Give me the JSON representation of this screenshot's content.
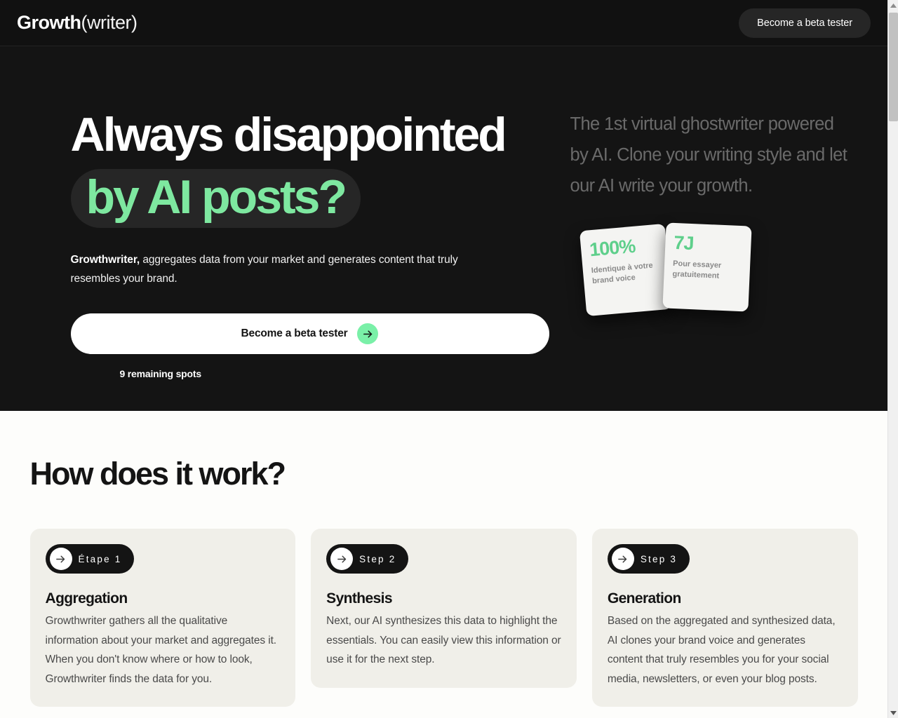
{
  "colors": {
    "hero_bg": "#141414",
    "header_bg": "#111111",
    "page_bg": "#fdfdfb",
    "accent_green": "#7ee8a0",
    "arrow_green": "#7af0a8",
    "stat_green": "#5ecf8b",
    "card_bg": "#f0efe9",
    "pill_bg": "#262626",
    "muted_text": "#6a6a6a"
  },
  "header": {
    "logo": {
      "strong": "Growth",
      "light": "(writer)"
    },
    "cta_label": "Become a beta tester"
  },
  "hero": {
    "headline_line1": "Always disappointed",
    "headline_line2": "by AI posts?",
    "sub_bold": "Growthwriter,",
    "sub_rest": " aggregates data from your market and generates content that truly resembles your brand.",
    "cta_label": "Become a beta tester",
    "cta_icon": "arrow-right-icon",
    "remaining_spots": "9 remaining spots",
    "tagline": "The 1st virtual ghostwriter powered by AI.  Clone your writing style and let our AI write your growth.",
    "stat_cards": [
      {
        "value": "100%",
        "caption": "Identique à votre brand voice"
      },
      {
        "value": "7J",
        "caption": "Pour essayer gratuitement"
      }
    ]
  },
  "how_it_works": {
    "title": "How does it work?",
    "steps": [
      {
        "badge": "Étape 1",
        "badge_icon": "arrow-right-icon",
        "heading": "Aggregation",
        "body": "Growthwriter gathers all the qualitative information about your market and aggregates it. When you don't know where or how to look, Growthwriter finds the data for you."
      },
      {
        "badge": "Step 2",
        "badge_icon": "arrow-right-icon",
        "heading": "Synthesis",
        "body": "Next, our AI synthesizes this data to highlight the essentials. You can easily view this information or use it for the next step."
      },
      {
        "badge": "Step 3",
        "badge_icon": "arrow-right-icon",
        "heading": "Generation",
        "body": "Based on the aggregated and synthesized data, AI clones your brand voice and generates content that truly resembles you for your social media, newsletters, or even your blog posts."
      }
    ]
  },
  "scrollbar": {
    "up_icon": "triangle-up-icon",
    "down_icon": "triangle-down-icon",
    "thumb": "scrollbar-thumb"
  }
}
